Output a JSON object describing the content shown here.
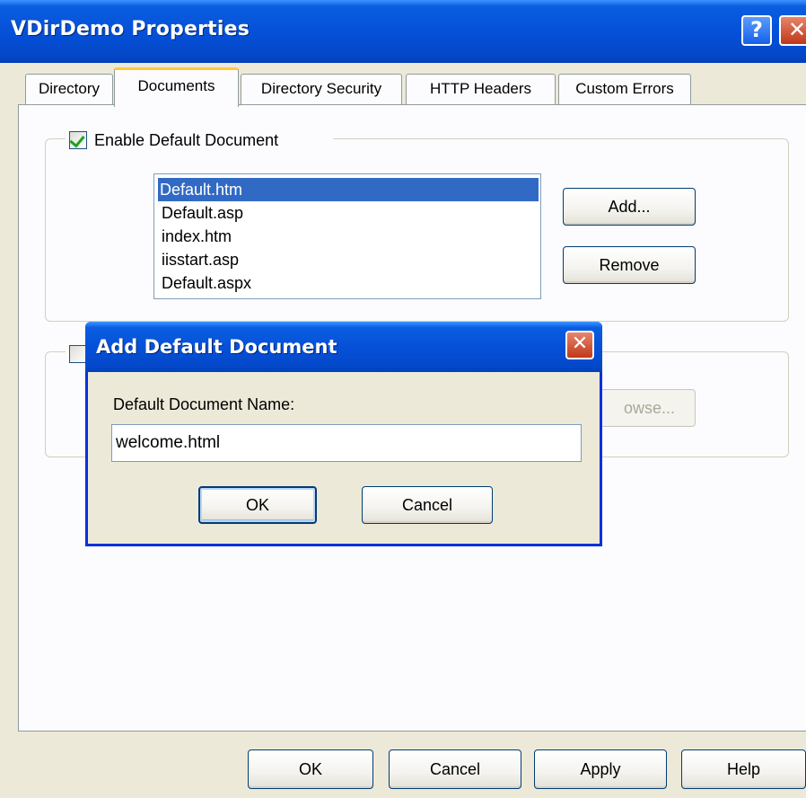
{
  "window": {
    "title": "VDirDemo Properties",
    "help_glyph": "?",
    "close_glyph": "✕"
  },
  "tabs": [
    {
      "label": "Directory",
      "active": false
    },
    {
      "label": "Documents",
      "active": true
    },
    {
      "label": "Directory Security",
      "active": false
    },
    {
      "label": "HTTP Headers",
      "active": false
    },
    {
      "label": "Custom Errors",
      "active": false
    }
  ],
  "default_document": {
    "enable_label": "Enable Default Document",
    "enabled": true,
    "move_up_glyph": "↑",
    "move_down_glyph": "↓",
    "documents": [
      "Default.htm",
      "Default.asp",
      "index.htm",
      "iisstart.asp",
      "Default.aspx"
    ],
    "selected_index": 0,
    "add_label": "Add...",
    "remove_label": "Remove"
  },
  "footer_section": {
    "enabled": false,
    "browse_label_visible": "owse..."
  },
  "dialog": {
    "title": "Add Default Document",
    "close_glyph": "✕",
    "field_label": "Default Document Name:",
    "field_value": "welcome.html",
    "ok_label": "OK",
    "cancel_label": "Cancel"
  },
  "bottom_buttons": {
    "ok": "OK",
    "cancel": "Cancel",
    "apply": "Apply",
    "help": "Help"
  },
  "colors": {
    "titlebar_blue": "#0551d8",
    "selection": "#316ac5",
    "active_tab_accent": "#ffc83c",
    "close_red": "#c1381a",
    "check_green": "#21a121"
  }
}
